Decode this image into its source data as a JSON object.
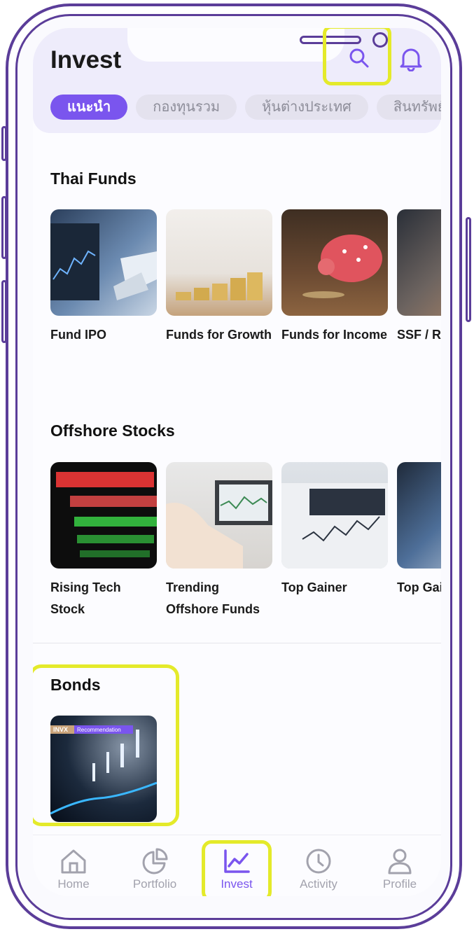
{
  "header": {
    "title": "Invest"
  },
  "icons": {
    "search": "search-icon",
    "bell": "bell-icon"
  },
  "chips": [
    "แนะนำ",
    "กองทุนรวม",
    "หุ้นต่างประเทศ",
    "สินทรัพย์"
  ],
  "sections": {
    "thai_funds": {
      "title": "Thai Funds",
      "items": [
        "Fund IPO",
        "Funds for Growth",
        "Funds for Income",
        "SSF / RMF"
      ]
    },
    "offshore": {
      "title": "Offshore Stocks",
      "items": [
        "Rising Tech Stock",
        "Trending Offshore Funds",
        "Top Gainer",
        "Top Gainer"
      ]
    },
    "bonds": {
      "title": "Bonds",
      "badge_brand": "INVX",
      "badge_text": "Recommendation"
    }
  },
  "tabbar": {
    "items": [
      "Home",
      "Portfolio",
      "Invest",
      "Activity",
      "Profile"
    ],
    "active": "Invest"
  },
  "colors": {
    "accent": "#7a55ee",
    "frame": "#5b3d99",
    "highlight": "#e4ea2a",
    "header_bg": "#eeecfb"
  }
}
